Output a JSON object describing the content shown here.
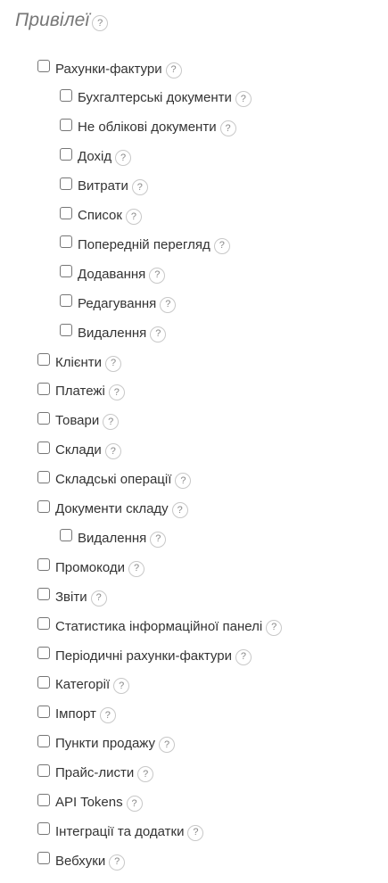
{
  "header": {
    "title": "Привілеї",
    "help_label": "?"
  },
  "privileges": [
    {
      "label": "Рахунки-фактури",
      "level": 1,
      "checked": false
    },
    {
      "label": "Бухгалтерські документи",
      "level": 2,
      "checked": false
    },
    {
      "label": "Не облікові документи",
      "level": 2,
      "checked": false
    },
    {
      "label": "Дохід",
      "level": 2,
      "checked": false
    },
    {
      "label": "Витрати",
      "level": 2,
      "checked": false
    },
    {
      "label": "Список",
      "level": 2,
      "checked": false
    },
    {
      "label": "Попередній перегляд",
      "level": 2,
      "checked": false
    },
    {
      "label": "Додавання",
      "level": 2,
      "checked": false
    },
    {
      "label": "Редагування",
      "level": 2,
      "checked": false
    },
    {
      "label": "Видалення",
      "level": 2,
      "checked": false
    },
    {
      "label": "Клієнти",
      "level": 1,
      "checked": false
    },
    {
      "label": "Платежі",
      "level": 1,
      "checked": false
    },
    {
      "label": "Товари",
      "level": 1,
      "checked": false
    },
    {
      "label": "Склади",
      "level": 1,
      "checked": false
    },
    {
      "label": "Складські операції",
      "level": 1,
      "checked": false
    },
    {
      "label": "Документи складу",
      "level": 1,
      "checked": false
    },
    {
      "label": "Видалення",
      "level": 2,
      "checked": false
    },
    {
      "label": "Промокоди",
      "level": 1,
      "checked": false
    },
    {
      "label": "Звіти",
      "level": 1,
      "checked": false
    },
    {
      "label": "Статистика інформаційної панелі",
      "level": 1,
      "checked": false
    },
    {
      "label": "Періодичні рахунки-фактури",
      "level": 1,
      "checked": false
    },
    {
      "label": "Категорії",
      "level": 1,
      "checked": false
    },
    {
      "label": "Імпорт",
      "level": 1,
      "checked": false
    },
    {
      "label": "Пункти продажу",
      "level": 1,
      "checked": false
    },
    {
      "label": "Прайс-листи",
      "level": 1,
      "checked": false
    },
    {
      "label": "API Tokens",
      "level": 1,
      "checked": false
    },
    {
      "label": "Інтеграції та додатки",
      "level": 1,
      "checked": false
    },
    {
      "label": "Вебхуки",
      "level": 1,
      "checked": false
    }
  ]
}
